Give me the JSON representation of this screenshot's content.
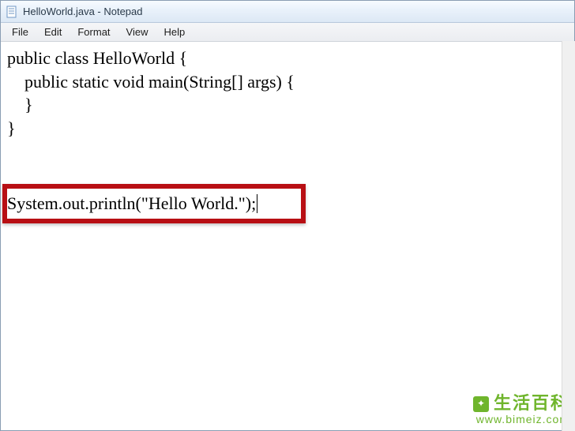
{
  "titlebar": {
    "icon_name": "notepad-icon",
    "title": "HelloWorld.java - Notepad"
  },
  "menubar": {
    "items": [
      "File",
      "Edit",
      "Format",
      "View",
      "Help"
    ]
  },
  "editor": {
    "lines": [
      "public class HelloWorld {",
      "    public static void main(String[] args) {",
      "    }",
      "}"
    ],
    "highlighted_line": "System.out.println(\"Hello World.\");"
  },
  "watermark": {
    "text": "生活百科",
    "url": "www.bimeiz.com"
  }
}
